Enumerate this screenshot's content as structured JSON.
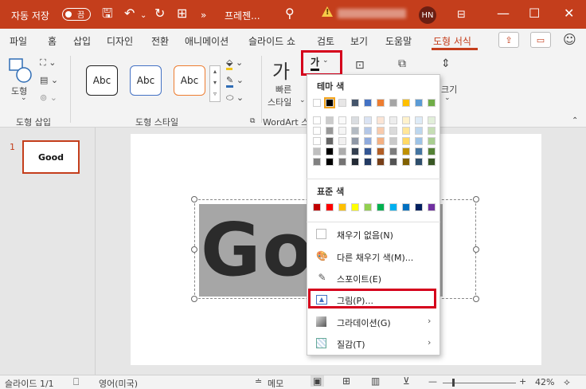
{
  "title_bar": {
    "autosave_label": "자동 저장",
    "autosave_state": "끔",
    "doc_title": "프레젠...",
    "user_initials": "HN"
  },
  "tabs": [
    "파일",
    "홈",
    "삽입",
    "디자인",
    "전환",
    "애니메이션",
    "슬라이드 쇼",
    "검토",
    "보기",
    "도움말",
    "도형 서식"
  ],
  "ribbon": {
    "shape_label": "도형",
    "group_insert_shapes": "도형 삽입",
    "style_samples": [
      "Abc",
      "Abc",
      "Abc"
    ],
    "group_shape_styles": "도형 스타일",
    "quick_label": "빠른",
    "style_label": "스타일",
    "group_wordart": "WordArt 스",
    "size_label": "크기",
    "fill_glyph": "가"
  },
  "slide_panel": {
    "slide_number": "1",
    "thumb_text": "Good"
  },
  "slide": {
    "text": "Goo"
  },
  "dropdown": {
    "theme_colors_label": "테마 색",
    "standard_colors_label": "표준 색",
    "items": [
      {
        "label": "채우기 없음(N)",
        "icon": "no-fill-icon"
      },
      {
        "label": "다른 채우기 색(M)...",
        "icon": "palette-icon"
      },
      {
        "label": "스포이트(E)",
        "icon": "eyedropper-icon"
      },
      {
        "label": "그림(P)...",
        "icon": "picture-icon"
      },
      {
        "label": "그라데이션(G)",
        "icon": "gradient-icon"
      },
      {
        "label": "질감(T)",
        "icon": "texture-icon"
      }
    ],
    "theme_row": [
      "#ffffff",
      "#000000",
      "#e7e6e6",
      "#44546a",
      "#4472c4",
      "#ed7d31",
      "#a5a5a5",
      "#ffc000",
      "#5b9bd5",
      "#70ad47"
    ],
    "standard_row": [
      "#c00000",
      "#ff0000",
      "#ffc000",
      "#ffff00",
      "#92d050",
      "#00b050",
      "#00b0f0",
      "#0070c0",
      "#002060",
      "#7030a0"
    ]
  },
  "status_bar": {
    "slide_info": "슬라이드 1/1",
    "language": "영어(미국)",
    "notes": "메모",
    "zoom": "42%"
  },
  "colors": {
    "accent": "#c43e1c",
    "highlight": "#d5001c"
  }
}
